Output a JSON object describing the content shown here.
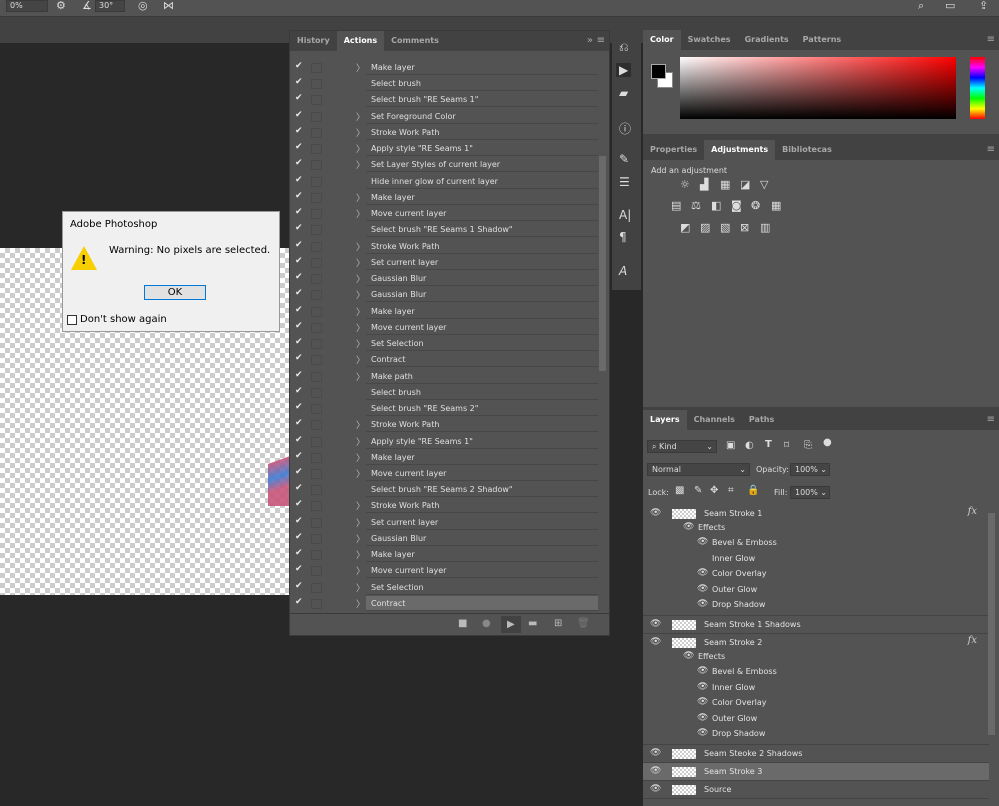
{
  "options_bar": {
    "opacity_value": "0%",
    "angle_value": "30°",
    "icons": [
      "gear-icon",
      "angle-icon",
      "target-icon",
      "butterfly-icon",
      "search-icon",
      "workspace-icon",
      "share-icon"
    ]
  },
  "dialog": {
    "title": "Adobe Photoshop",
    "message": "Warning: No pixels are selected.",
    "ok_label": "OK",
    "checkbox_label": "Don't show again",
    "checkbox_checked": false
  },
  "actions_panel": {
    "tabs": [
      {
        "label": "History"
      },
      {
        "label": "Actions",
        "active": true
      },
      {
        "label": "Comments"
      }
    ],
    "rows": [
      {
        "label": "Make layer",
        "expandable": true
      },
      {
        "label": "Select brush",
        "expandable": false
      },
      {
        "label": "Select brush \"RE Seams 1\"",
        "expandable": false
      },
      {
        "label": "Set Foreground Color",
        "expandable": true
      },
      {
        "label": "Stroke Work Path",
        "expandable": true
      },
      {
        "label": "Apply style \"RE Seams 1\"",
        "expandable": true
      },
      {
        "label": "Set Layer Styles of current layer",
        "expandable": true
      },
      {
        "label": "Hide inner glow of current layer",
        "expandable": false
      },
      {
        "label": "Make layer",
        "expandable": true
      },
      {
        "label": "Move current layer",
        "expandable": true
      },
      {
        "label": "Select brush \"RE Seams 1 Shadow\"",
        "expandable": false
      },
      {
        "label": "Stroke Work Path",
        "expandable": true
      },
      {
        "label": "Set current layer",
        "expandable": true
      },
      {
        "label": "Gaussian Blur",
        "expandable": true
      },
      {
        "label": "Gaussian Blur",
        "expandable": true
      },
      {
        "label": "Make layer",
        "expandable": true
      },
      {
        "label": "Move current layer",
        "expandable": true
      },
      {
        "label": "Set Selection",
        "expandable": true
      },
      {
        "label": "Contract",
        "expandable": true
      },
      {
        "label": "Make path",
        "expandable": true
      },
      {
        "label": "Select brush",
        "expandable": false
      },
      {
        "label": "Select brush \"RE Seams 2\"",
        "expandable": false
      },
      {
        "label": "Stroke Work Path",
        "expandable": true
      },
      {
        "label": "Apply style \"RE Seams 1\"",
        "expandable": true
      },
      {
        "label": "Make layer",
        "expandable": true
      },
      {
        "label": "Move current layer",
        "expandable": true
      },
      {
        "label": "Select brush \"RE Seams 2 Shadow\"",
        "expandable": false
      },
      {
        "label": "Stroke Work Path",
        "expandable": true
      },
      {
        "label": "Set current layer",
        "expandable": true
      },
      {
        "label": "Gaussian Blur",
        "expandable": true
      },
      {
        "label": "Make layer",
        "expandable": true
      },
      {
        "label": "Move current layer",
        "expandable": true
      },
      {
        "label": "Set Selection",
        "expandable": true
      },
      {
        "label": "Contract",
        "expandable": true,
        "selected": true
      }
    ]
  },
  "color_panel": {
    "tabs": [
      "Color",
      "Swatches",
      "Gradients",
      "Patterns"
    ],
    "foreground": "#000000",
    "background": "#ffffff",
    "hue": "#ff0000"
  },
  "adjustments_panel": {
    "tabs": [
      "Properties",
      "Adjustments",
      "Bibliotecas"
    ],
    "heading": "Add an adjustment"
  },
  "layers_panel": {
    "tabs": [
      "Layers",
      "Channels",
      "Paths"
    ],
    "filter_kind": "Kind",
    "blend_mode": "Normal",
    "opacity_label": "Opacity:",
    "opacity": "100%",
    "lock_label": "Lock:",
    "fill_label": "Fill:",
    "fill": "100%",
    "layers": [
      {
        "name": "Seam Stroke 1",
        "fx": true,
        "effects_label": "Effects",
        "effects": [
          {
            "name": "Bevel & Emboss",
            "visible": true
          },
          {
            "name": "Inner Glow",
            "visible": false
          },
          {
            "name": "Color Overlay",
            "visible": true
          },
          {
            "name": "Outer Glow",
            "visible": true
          },
          {
            "name": "Drop Shadow",
            "visible": true
          }
        ]
      },
      {
        "name": "Seam Stroke 1 Shadows"
      },
      {
        "name": "Seam Stroke 2",
        "fx": true,
        "effects_label": "Effects",
        "effects": [
          {
            "name": "Bevel & Emboss",
            "visible": true
          },
          {
            "name": "Inner Glow",
            "visible": true
          },
          {
            "name": "Color Overlay",
            "visible": true
          },
          {
            "name": "Outer Glow",
            "visible": true
          },
          {
            "name": "Drop Shadow",
            "visible": true
          }
        ]
      },
      {
        "name": "Seam Steoke 2 Shadows"
      },
      {
        "name": "Seam Stroke 3",
        "selected": true
      },
      {
        "name": "Source"
      }
    ]
  }
}
